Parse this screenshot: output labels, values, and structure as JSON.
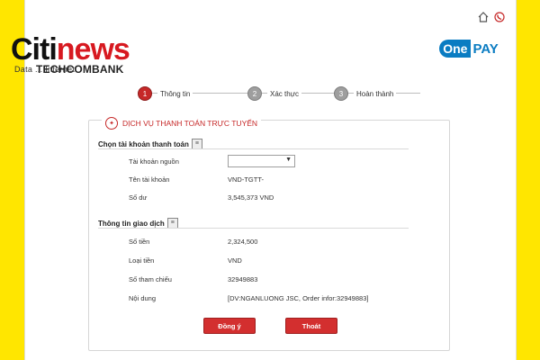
{
  "watermark": {
    "logo_left": "Citi",
    "logo_right": "news",
    "tagline": "Data ... Internet"
  },
  "brand": {
    "bank": "TECHCOMBANK"
  },
  "icons": {
    "home": "home-icon",
    "phone": "phone-icon"
  },
  "onepay": {
    "one": "One",
    "pay": "PAY"
  },
  "steps": [
    {
      "num": "1",
      "label": "Thông tin",
      "active": true
    },
    {
      "num": "2",
      "label": "Xác thực",
      "active": false
    },
    {
      "num": "3",
      "label": "Hoàn thành",
      "active": false
    }
  ],
  "panel": {
    "title": "DỊCH VỤ THANH TOÁN TRỰC TUYẾN",
    "section1": {
      "title": "Chọn tài khoản thanh toán"
    },
    "account": {
      "source_label": "Tài khoản nguồn",
      "source_value": "",
      "name_label": "Tên tài khoản",
      "name_value": "VND-TGTT-",
      "balance_label": "Số dư",
      "balance_value": "3,545,373 VND"
    },
    "section2": {
      "title": "Thông tin giao dịch"
    },
    "transaction": {
      "amount_label": "Số tiền",
      "amount_value": "2,324,500",
      "currency_label": "Loại tiền",
      "currency_value": "VND",
      "ref_label": "Số tham chiếu",
      "ref_value": "32949883",
      "content_label": "Nội dung",
      "content_value": "[DV:NGANLUONG JSC, Order infor:32949883]"
    },
    "buttons": {
      "agree": "Đồng ý",
      "exit": "Thoát"
    }
  },
  "colors": {
    "accent": "#d32f2f",
    "onepay_blue": "#0a7cc2",
    "background": "#ffe600"
  }
}
